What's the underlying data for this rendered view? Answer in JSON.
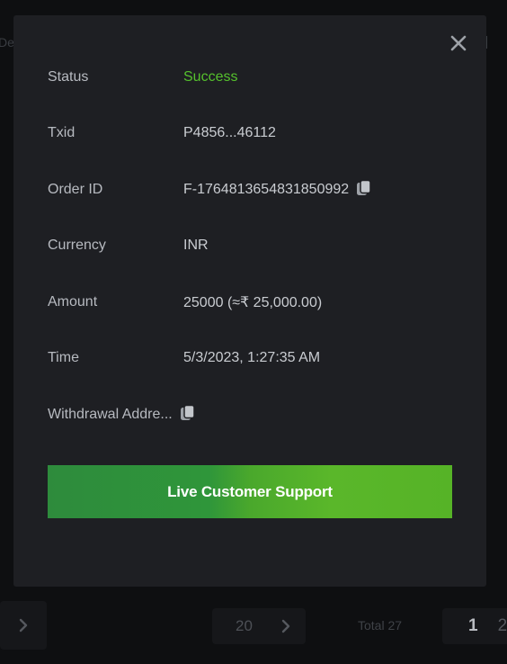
{
  "background": {
    "left_fragment": "De",
    "pagination": {
      "page_size": "20",
      "total": "Total 27",
      "pages": [
        "1",
        "2"
      ],
      "current_page": "1"
    }
  },
  "modal": {
    "fields": [
      {
        "label": "Status",
        "value": "Success"
      },
      {
        "label": "Txid",
        "value": "P4856...46112"
      },
      {
        "label": "Order ID",
        "value": "F-1764813654831850992"
      },
      {
        "label": "Currency",
        "value": "INR"
      },
      {
        "label": "Amount",
        "value": "25000 (≈₹ 25,000.00)"
      },
      {
        "label": "Time",
        "value": "5/3/2023, 1:27:35 AM"
      }
    ],
    "withdrawal_address_label": "Withdrawal Addre...",
    "support_button_label": "Live Customer Support"
  },
  "colors": {
    "success": "#55c02d",
    "button_gradient_start": "#2e8b3c",
    "button_gradient_end": "#56b327",
    "modal_bg": "#1e1f23"
  },
  "icons": {
    "close": "close-icon",
    "copy": "copy-icon",
    "chevron": "chevron-right-icon"
  }
}
